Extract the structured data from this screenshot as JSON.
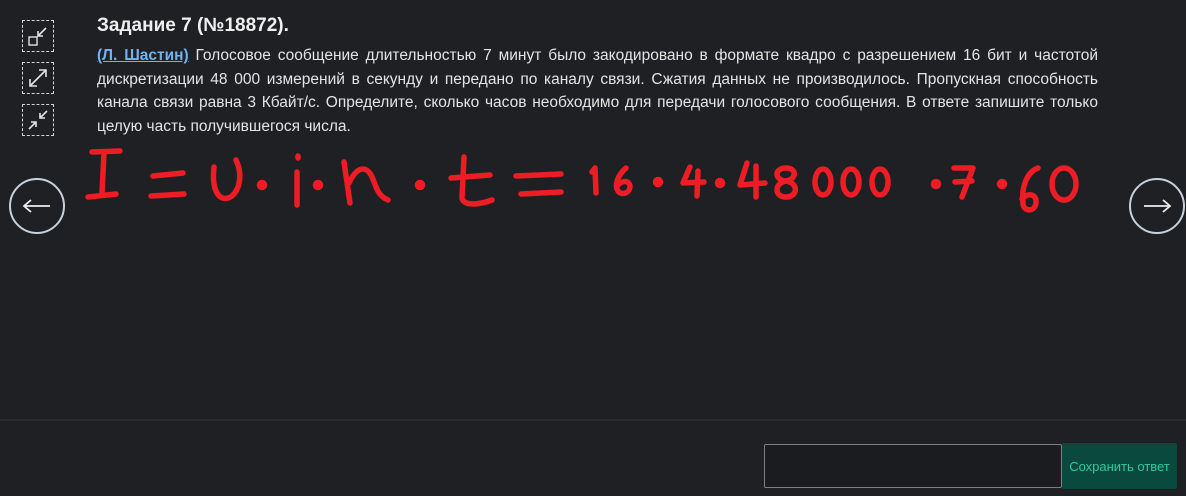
{
  "task": {
    "title": "Задание 7 (№18872).",
    "author": "(Л. Шастин)",
    "text": " Голосовое сообщение длительностью 7 минут было закодировано в формате квадро с разрешением 16 бит и частотой дискретизации 48 000 измерений в секунду и передано по каналу связи. Сжатия данных не производилось. Пропускная способность канала связи равна 3 Кбайт/с. Определите, сколько часов необходимо для передачи голосового сообщения. В ответе запишите только целую часть получившегося числа."
  },
  "tools": [
    "collapse-icon",
    "expand-icon",
    "shrink-icon"
  ],
  "nav": {
    "prev_label": "←",
    "next_label": "→"
  },
  "handwriting": {
    "color": "#ee1c24",
    "content": "I = υ · i · n · t = 16 · 4 · 48000 · 7 · 60"
  },
  "answer": {
    "value": "",
    "placeholder": "",
    "save_label": "Сохранить ответ"
  },
  "colors": {
    "background": "#1f2023",
    "link": "#6fb3f5",
    "save_bg": "#0a4a3e",
    "save_text": "#35c79d"
  }
}
